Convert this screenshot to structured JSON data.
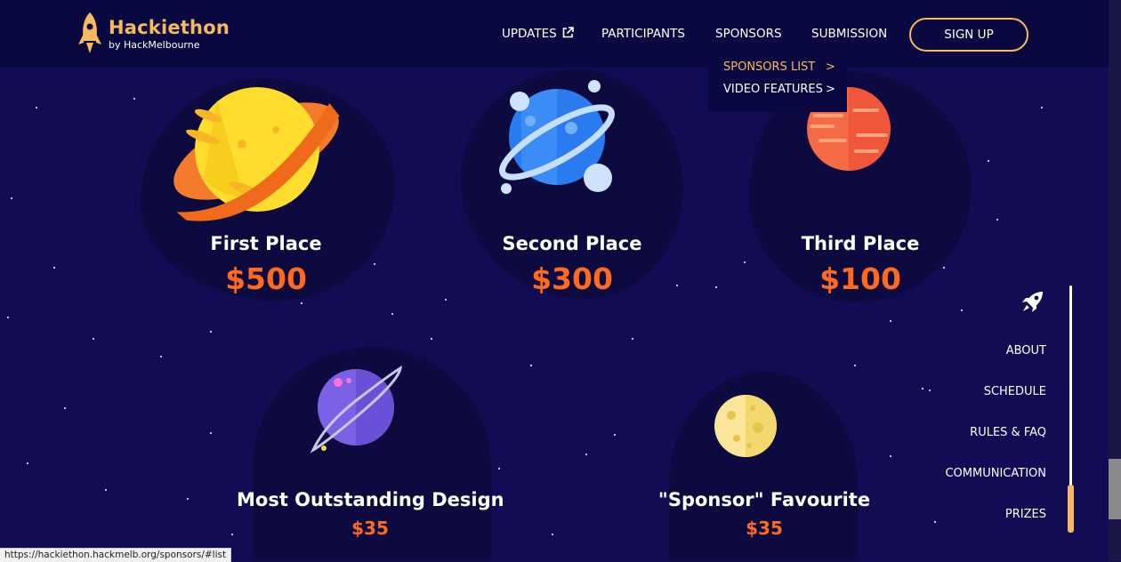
{
  "logo": {
    "title": "Hackiethon",
    "subtitle": "by HackMelbourne"
  },
  "nav": {
    "updates": "UPDATES",
    "participants": "PARTICIPANTS",
    "sponsors": "SPONSORS",
    "submission": "SUBMISSION",
    "signup": "SIGN UP"
  },
  "dropdown": {
    "items": [
      {
        "label": "SPONSORS LIST",
        "active": true
      },
      {
        "label": "VIDEO FEATURES",
        "active": false
      }
    ],
    "chevron": ">"
  },
  "prizes": [
    {
      "title": "First Place",
      "amount": "$500"
    },
    {
      "title": "Second Place",
      "amount": "$300"
    },
    {
      "title": "Third Place",
      "amount": "$100"
    },
    {
      "title": "Most Outstanding Design",
      "amount": "$35"
    },
    {
      "title": "\"Sponsor\" Favourite",
      "amount": "$35"
    }
  ],
  "side_nav": {
    "items": [
      "ABOUT",
      "SCHEDULE",
      "RULES & FAQ",
      "COMMUNICATION",
      "PRIZES"
    ],
    "active": "PRIZES"
  },
  "status_bar": {
    "url": "https://hackiethon.hackmelb.org/sponsors/#list"
  },
  "colors": {
    "background": "#120c55",
    "header": "#0a0840",
    "accent": "#f7b85f",
    "prize_amount": "#ff6a1f"
  },
  "icons": {
    "logo": "rocket-icon",
    "external_link": "external-link-icon",
    "side_nav": "rocket-icon"
  }
}
